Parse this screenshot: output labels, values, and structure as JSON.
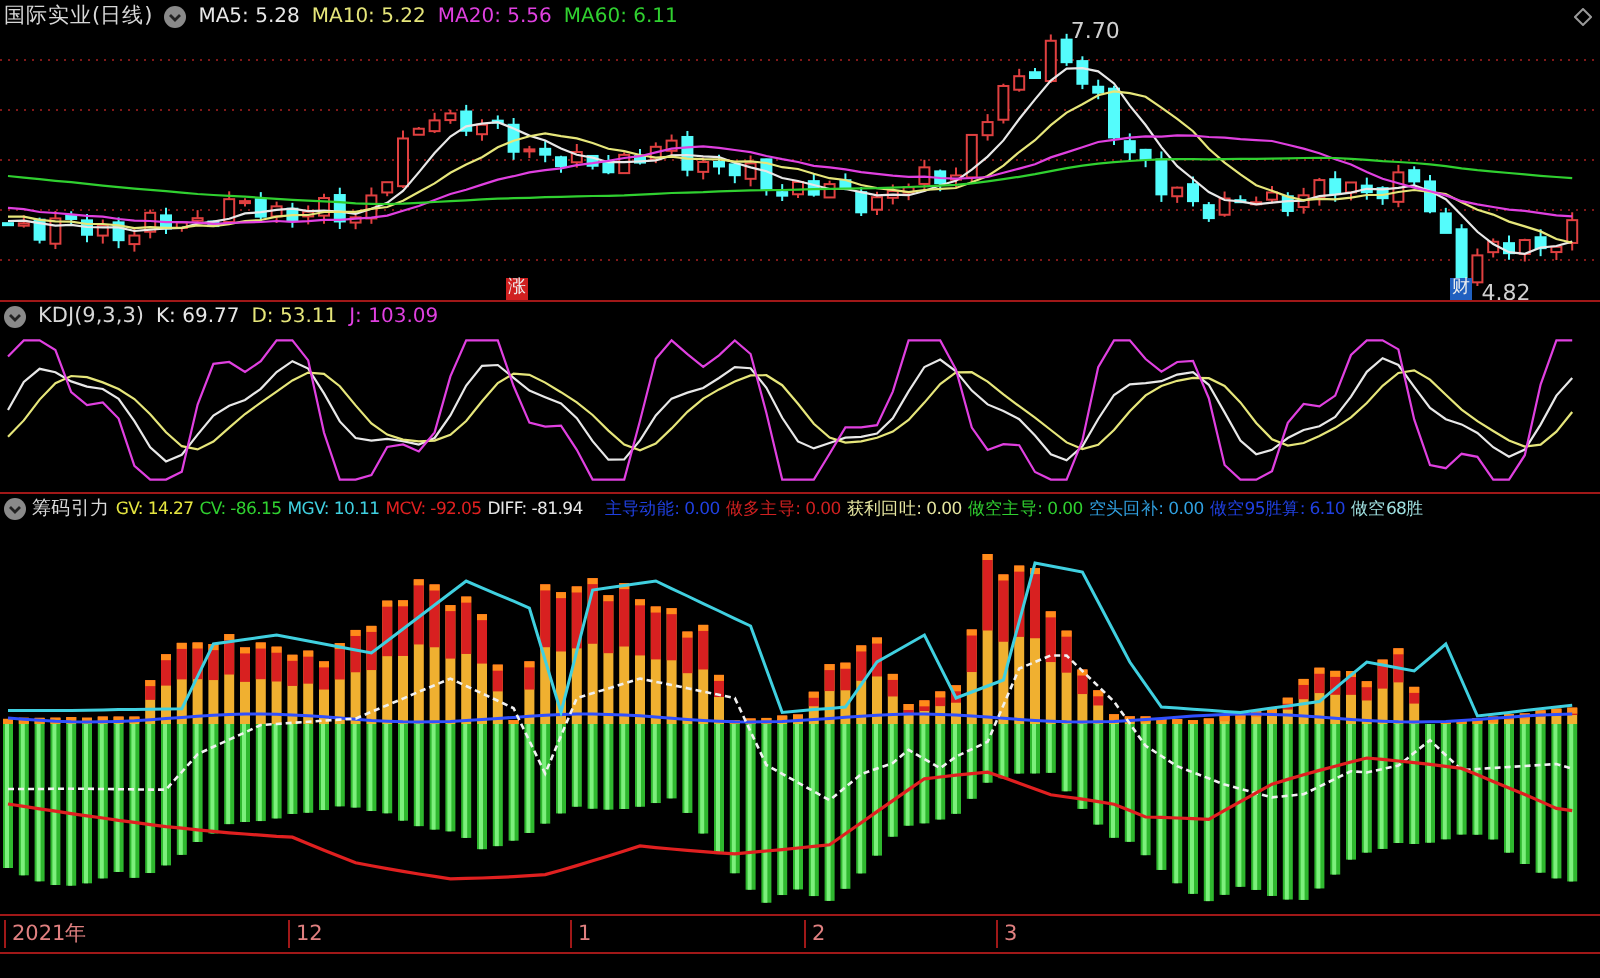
{
  "main_panel": {
    "title": "国际实业(日线)",
    "indicators": [
      {
        "label": "MA5: 5.28",
        "color": "#e8e8e8"
      },
      {
        "label": "MA10: 5.22",
        "color": "#e6e67a"
      },
      {
        "label": "MA20: 5.56",
        "color": "#e040e0"
      },
      {
        "label": "MA60: 6.11",
        "color": "#30d030"
      }
    ],
    "high_label": "7.70",
    "low_label": "4.82",
    "markers": [
      {
        "text": "涨",
        "color": "#d02020"
      },
      {
        "text": "财",
        "color": "#2060c0"
      }
    ]
  },
  "kdj_panel": {
    "title": "KDJ(9,3,3)",
    "indicators": [
      {
        "label": "K: 69.77",
        "color": "#e8e8e8"
      },
      {
        "label": "D: 53.11",
        "color": "#e6e67a"
      },
      {
        "label": "J: 103.09",
        "color": "#e040e0"
      }
    ]
  },
  "chip_panel": {
    "title": "筹码引力",
    "indicators": [
      {
        "label": "GV: 14.27",
        "color": "#e6e640"
      },
      {
        "label": "CV: -86.15",
        "color": "#30d030"
      },
      {
        "label": "MGV: 10.11",
        "color": "#40d0e0"
      },
      {
        "label": "MCV: -92.05",
        "color": "#e02020"
      },
      {
        "label": "DIFF: -81.94",
        "color": "#e8e8e8"
      },
      {
        "label": "主导动能: 0.00",
        "color": "#2040e0"
      },
      {
        "label": "做多主导: 0.00",
        "color": "#d02020"
      },
      {
        "label": "获利回吐: 0.00",
        "color": "#e6e6a0"
      },
      {
        "label": "做空主导: 0.00",
        "color": "#30d030"
      },
      {
        "label": "空头回补: 0.00",
        "color": "#30a0e0"
      },
      {
        "label": "做空95胜算: 6.10",
        "color": "#2040e0"
      },
      {
        "label": "做空68胜",
        "color": "#a0e0e0"
      }
    ]
  },
  "time_axis": {
    "labels": [
      "2021年",
      "12",
      "1",
      "2",
      "3"
    ]
  }
}
